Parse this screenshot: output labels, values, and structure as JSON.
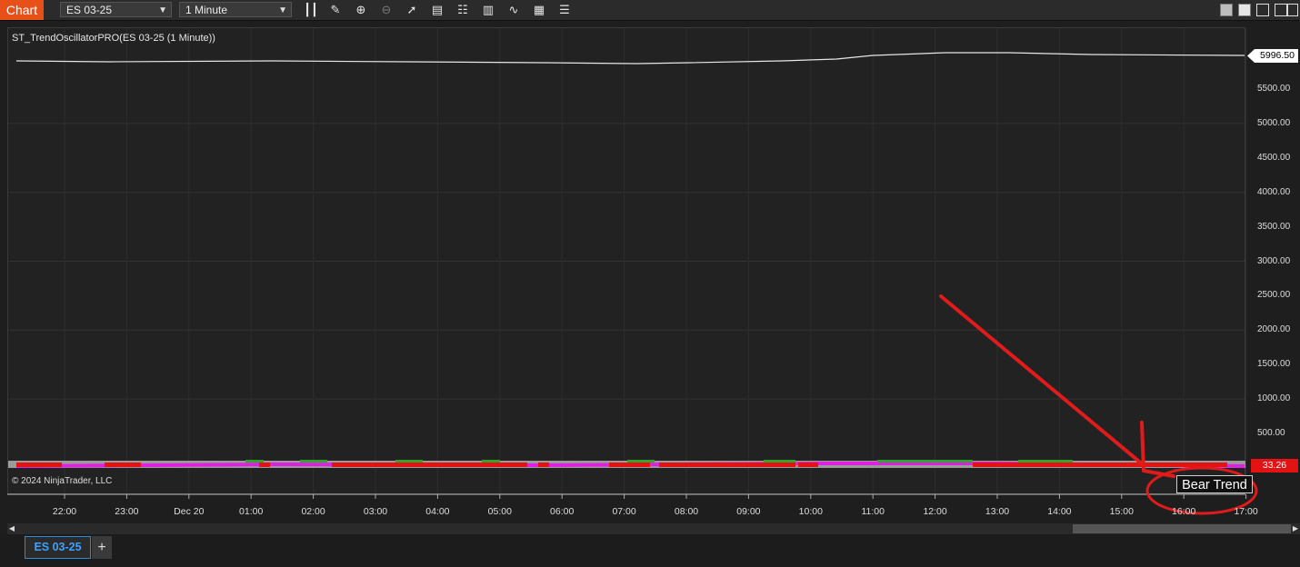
{
  "toolbar": {
    "chart_tab_label": "Chart",
    "instrument": "ES 03-25",
    "interval": "1 Minute",
    "icons": [
      "bars-type-icon",
      "draw-pencil-icon",
      "zoom-in-icon",
      "zoom-out-icon",
      "pointer-icon",
      "data-box-icon",
      "properties-icon",
      "strategies-icon",
      "indicators-icon",
      "chart-trader-icon",
      "menu-icon"
    ]
  },
  "window_controls": [
    "tile-icon",
    "minimize-icon",
    "maximize-icon",
    "close-icon"
  ],
  "chart": {
    "indicator_label": "ST_TrendOscillatorPRO(ES 03-25 (1 Minute))",
    "copyright": "© 2024 NinjaTrader, LLC",
    "price_tag": "5996.50",
    "oscillator_tag": "33.26",
    "trend_label": "Bear Trend",
    "y_ticks": [
      "5500.00",
      "5000.00",
      "4500.00",
      "4000.00",
      "3500.00",
      "3000.00",
      "2500.00",
      "2000.00",
      "1500.00",
      "1000.00",
      "500.00"
    ],
    "x_ticks": [
      "22:00",
      "23:00",
      "Dec 20",
      "01:00",
      "02:00",
      "03:00",
      "04:00",
      "05:00",
      "06:00",
      "07:00",
      "08:00",
      "09:00",
      "10:00",
      "11:00",
      "12:00",
      "13:00",
      "14:00",
      "15:00",
      "16:00",
      "17:00"
    ],
    "colors": {
      "price_line": "#e6e6e6",
      "oscillator_main": "#e020e0",
      "bear": "#e41313",
      "bull": "#2fa52f",
      "annotation": "#e01b1b"
    }
  },
  "bottom_tabs": {
    "active": "ES 03-25",
    "add_label": "+"
  }
}
